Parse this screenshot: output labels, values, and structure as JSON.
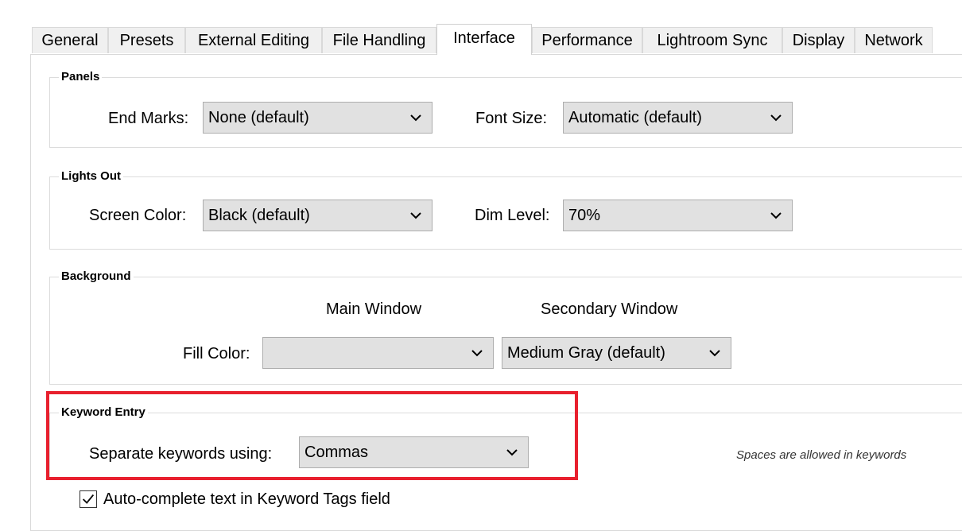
{
  "tabs": [
    {
      "label": "General"
    },
    {
      "label": "Presets"
    },
    {
      "label": "External Editing"
    },
    {
      "label": "File Handling"
    },
    {
      "label": "Interface"
    },
    {
      "label": "Performance"
    },
    {
      "label": "Lightroom Sync"
    },
    {
      "label": "Display"
    },
    {
      "label": "Network"
    }
  ],
  "active_tab": "Interface",
  "panels": {
    "title": "Panels",
    "end_marks_label": "End Marks:",
    "end_marks_value": "None (default)",
    "font_size_label": "Font Size:",
    "font_size_value": "Automatic (default)"
  },
  "lights_out": {
    "title": "Lights Out",
    "screen_color_label": "Screen Color:",
    "screen_color_value": "Black (default)",
    "dim_level_label": "Dim Level:",
    "dim_level_value": "70%"
  },
  "background": {
    "title": "Background",
    "main_window_header": "Main Window",
    "secondary_window_header": "Secondary Window",
    "fill_color_label": "Fill Color:",
    "main_fill_value": "",
    "secondary_fill_value": "Medium Gray (default)"
  },
  "keyword_entry": {
    "title": "Keyword Entry",
    "separate_label": "Separate keywords using:",
    "separate_value": "Commas",
    "note": "Spaces are allowed in keywords",
    "autocomplete_label": "Auto-complete text in Keyword Tags field",
    "autocomplete_checked": true
  },
  "colors": {
    "highlight": "#e8202e",
    "dropdown_bg": "#e1e1e1"
  }
}
